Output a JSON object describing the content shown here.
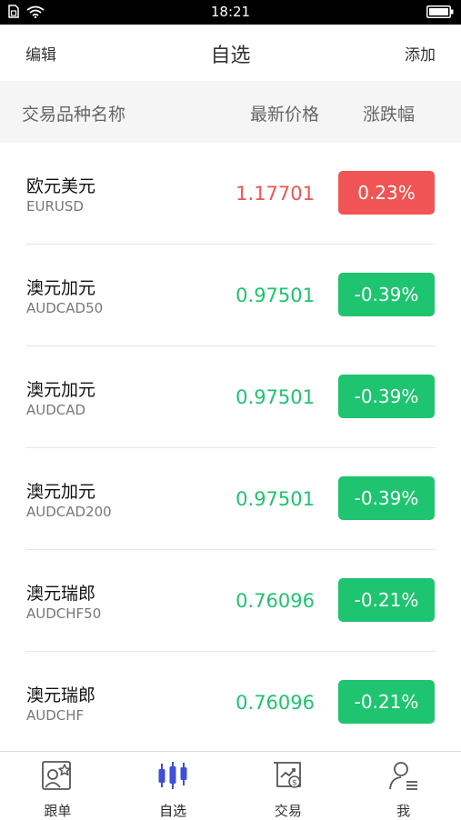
{
  "status_bar": {
    "time": "18:21"
  },
  "nav": {
    "left": "编辑",
    "title": "自选",
    "right": "添加"
  },
  "header": {
    "name": "交易品种名称",
    "price": "最新价格",
    "change": "涨跌幅"
  },
  "colors": {
    "up": "#f05454",
    "down": "#1ec46f"
  },
  "rows": [
    {
      "name": "欧元美元",
      "code": "EURUSD",
      "price": "1.17701",
      "change": "0.23%",
      "direction": "up"
    },
    {
      "name": "澳元加元",
      "code": "AUDCAD50",
      "price": "0.97501",
      "change": "-0.39%",
      "direction": "down"
    },
    {
      "name": "澳元加元",
      "code": "AUDCAD",
      "price": "0.97501",
      "change": "-0.39%",
      "direction": "down"
    },
    {
      "name": "澳元加元",
      "code": "AUDCAD200",
      "price": "0.97501",
      "change": "-0.39%",
      "direction": "down"
    },
    {
      "name": "澳元瑞郎",
      "code": "AUDCHF50",
      "price": "0.76096",
      "change": "-0.21%",
      "direction": "down"
    },
    {
      "name": "澳元瑞郎",
      "code": "AUDCHF",
      "price": "0.76096",
      "change": "-0.21%",
      "direction": "down"
    }
  ],
  "tabs": [
    {
      "label": "跟单",
      "icon": "follow-star-icon",
      "active": false
    },
    {
      "label": "自选",
      "icon": "candlestick-icon",
      "active": true
    },
    {
      "label": "交易",
      "icon": "trade-chart-icon",
      "active": false
    },
    {
      "label": "我",
      "icon": "profile-icon",
      "active": false
    }
  ]
}
